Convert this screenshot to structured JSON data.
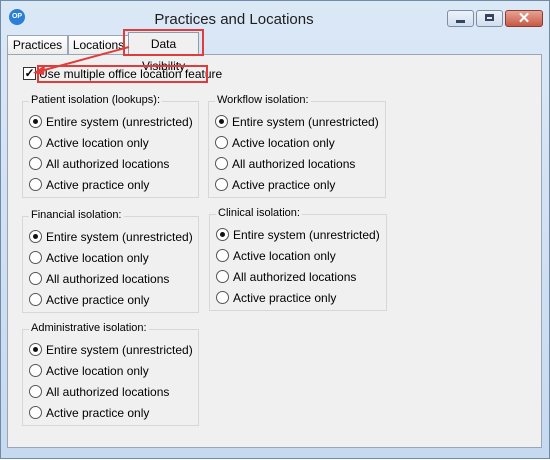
{
  "window": {
    "title": "Practices and Locations",
    "app_icon": "OP"
  },
  "tabs": [
    {
      "label": "Practices",
      "active": false
    },
    {
      "label": "Locations",
      "active": false
    },
    {
      "label": "Data Visibility",
      "active": true
    }
  ],
  "multi_location": {
    "label": "Use multiple office location feature",
    "checked": true,
    "check_glyph": "✓"
  },
  "options": [
    "Entire system (unrestricted)",
    "Active location only",
    "All authorized locations",
    "Active practice only"
  ],
  "groups": [
    {
      "title": "Patient isolation (lookups):",
      "selected": 0
    },
    {
      "title": "Workflow isolation:",
      "selected": 0
    },
    {
      "title": "Financial isolation:",
      "selected": 0
    },
    {
      "title": "Clinical isolation:",
      "selected": 0
    },
    {
      "title": "Administrative isolation:",
      "selected": 0
    }
  ],
  "colors": {
    "highlight": "#e03c3c",
    "close_button": "#c75a44"
  }
}
